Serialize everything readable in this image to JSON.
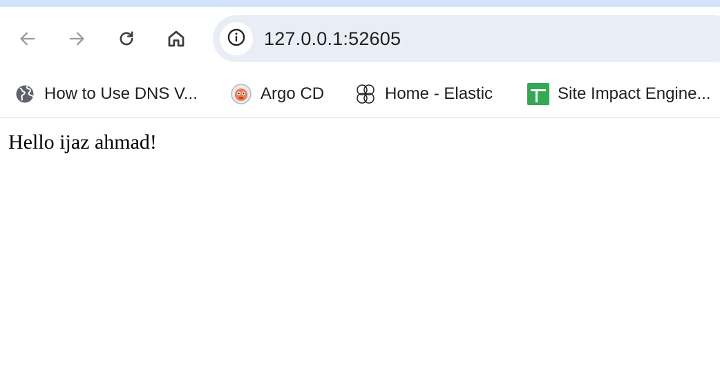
{
  "browser": {
    "nav": {
      "back_icon": "arrow-left-icon",
      "forward_icon": "arrow-right-icon",
      "reload_icon": "reload-icon",
      "home_icon": "home-icon"
    },
    "address_bar": {
      "site_info_icon": "info-icon",
      "url": "127.0.0.1:52605"
    },
    "bookmarks": [
      {
        "label": "How to Use DNS V...",
        "icon": "globe-icon"
      },
      {
        "label": "Argo CD",
        "icon": "argo-logo-icon"
      },
      {
        "label": "Home - Elastic",
        "icon": "elastic-logo-icon"
      },
      {
        "label": "Site Impact Engine...",
        "icon": "sheets-icon"
      }
    ],
    "colors": {
      "frame": "#d3e3fd",
      "omnibox": "#e9eef6",
      "sheets_green": "#34a853"
    }
  },
  "page": {
    "greeting": "Hello ijaz ahmad!"
  }
}
